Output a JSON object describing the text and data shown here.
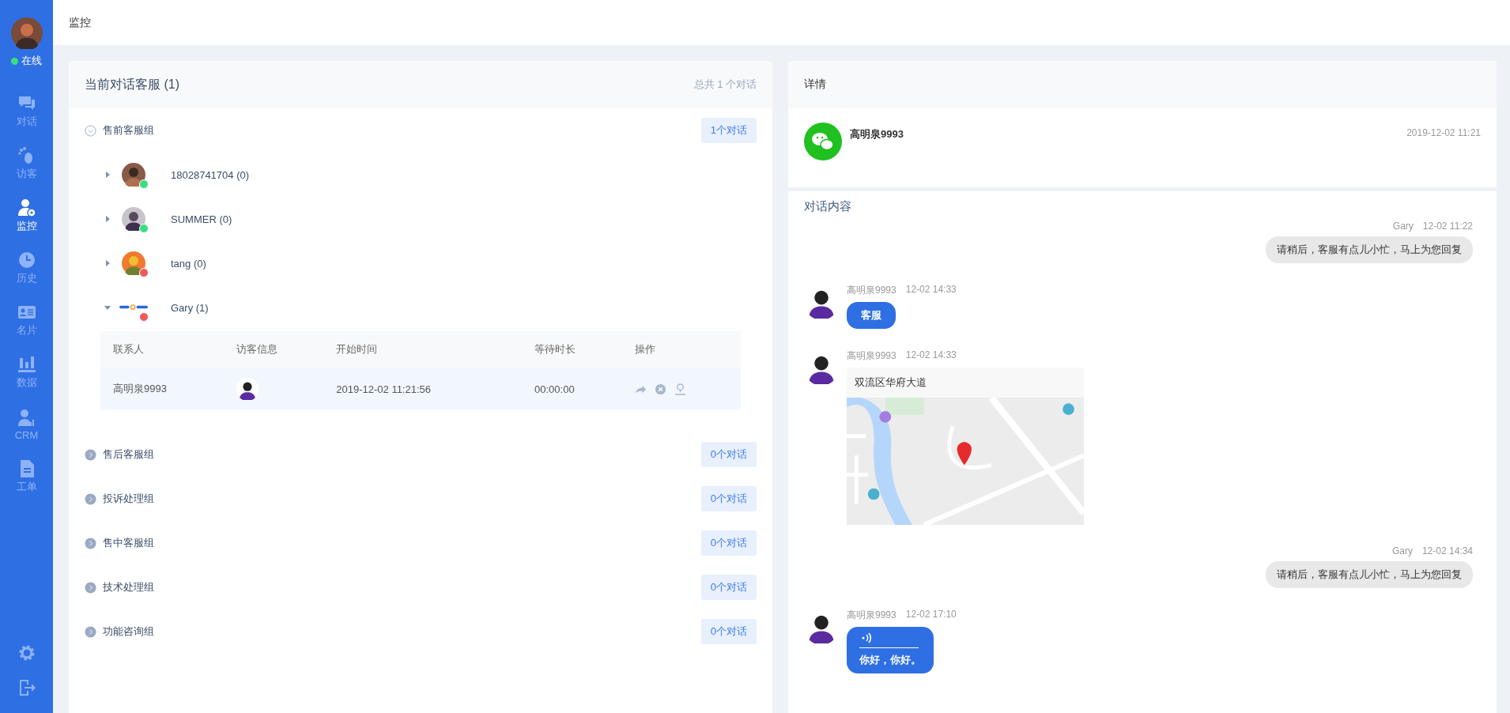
{
  "header": {
    "title": "监控"
  },
  "sidebar": {
    "status": {
      "label": "在线",
      "online": true
    },
    "items": [
      {
        "kind": "chat",
        "label": "对话",
        "selected": false
      },
      {
        "kind": "footprint",
        "label": "访客",
        "selected": false
      },
      {
        "kind": "monitor",
        "label": "监控",
        "selected": true
      },
      {
        "kind": "clock",
        "label": "历史",
        "selected": false
      },
      {
        "kind": "card",
        "label": "名片",
        "selected": false
      },
      {
        "kind": "chart",
        "label": "数据",
        "selected": false
      },
      {
        "kind": "crm",
        "label": "CRM",
        "selected": false
      },
      {
        "kind": "doc",
        "label": "工单",
        "selected": false
      }
    ],
    "bottom": [
      {
        "kind": "settings"
      },
      {
        "kind": "logout"
      }
    ]
  },
  "left_panel": {
    "title": "当前对话客服 (1)",
    "summary": "总共 1 个对话",
    "groups": [
      {
        "name": "售前客服组",
        "badge": "1个对话",
        "expanded": true,
        "agents": [
          {
            "name": "18028741704 (0)",
            "online": true,
            "expanded": false
          },
          {
            "name": "SUMMER (0)",
            "online": true,
            "expanded": false
          },
          {
            "name": "tang (0)",
            "online": false,
            "expanded": false
          },
          {
            "name": "Gary (1)",
            "kind": "logo",
            "online": false,
            "expanded": true,
            "table": {
              "columns": [
                "联系人",
                "访客信息",
                "开始时间",
                "等待时长",
                "操作"
              ],
              "rows": [
                {
                  "contact": "高明泉9993",
                  "start": "2019-12-02 11:21:56",
                  "wait": "00:00:00"
                }
              ]
            }
          }
        ]
      },
      {
        "name": "售后客服组",
        "badge": "0个对话",
        "expanded": false
      },
      {
        "name": "投诉处理组",
        "badge": "0个对话",
        "expanded": false
      },
      {
        "name": "售中客服组",
        "badge": "0个对话",
        "expanded": false
      },
      {
        "name": "技术处理组",
        "badge": "0个对话",
        "expanded": false
      },
      {
        "name": "功能咨询组",
        "badge": "0个对话",
        "expanded": false
      }
    ]
  },
  "right_panel": {
    "details_title": "详情",
    "contact": {
      "name": "高明泉9993",
      "time": "2019-12-02 11:21"
    },
    "chat_title": "对话内容",
    "messages": [
      {
        "kind": "agent",
        "sender": "Gary",
        "time": "12-02 11:22",
        "text": "请稍后，客服有点儿小忙，马上为您回复"
      },
      {
        "kind": "visitor",
        "sender": "高明泉9993",
        "time": "12-02 14:33",
        "text": "客服"
      },
      {
        "kind": "location",
        "sender": "高明泉9993",
        "time": "12-02 14:33",
        "address": "双流区华府大道"
      },
      {
        "kind": "agent",
        "sender": "Gary",
        "time": "12-02 14:34",
        "text": "请稍后，客服有点儿小忙，马上为您回复"
      },
      {
        "kind": "voice",
        "sender": "高明泉9993",
        "time": "12-02 17:10",
        "text": "你好，你好。"
      }
    ]
  }
}
